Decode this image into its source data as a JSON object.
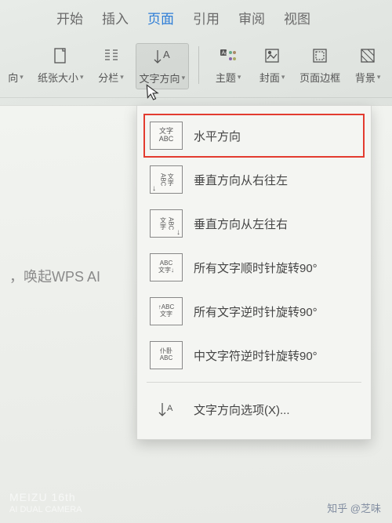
{
  "tabs": {
    "start": "开始",
    "insert": "插入",
    "page": "页面",
    "reference": "引用",
    "review": "审阅",
    "view": "视图"
  },
  "tools": {
    "orientation": "向",
    "paper_size": "纸张大小",
    "columns": "分栏",
    "text_direction": "文字方向",
    "theme": "主题",
    "cover": "封面",
    "page_border": "页面边框",
    "background": "背景"
  },
  "doc_hint": "，唤起WPS AI",
  "menu": {
    "horizontal": "水平方向",
    "vertical_rtl": "垂直方向从右往左",
    "vertical_ltr": "垂直方向从左往右",
    "rotate_cw": "所有文字顺时针旋转90°",
    "rotate_ccw": "所有文字逆时针旋转90°",
    "chinese_ccw": "中文字符逆时针旋转90°",
    "options": "文字方向选项(X)...",
    "icon_text_top": "文字",
    "icon_text_bottom": "ABC"
  },
  "watermark": {
    "brand": "MEIZU 16th",
    "sub": "AI DUAL CAMERA",
    "zhihu": "知乎 @芝味"
  }
}
